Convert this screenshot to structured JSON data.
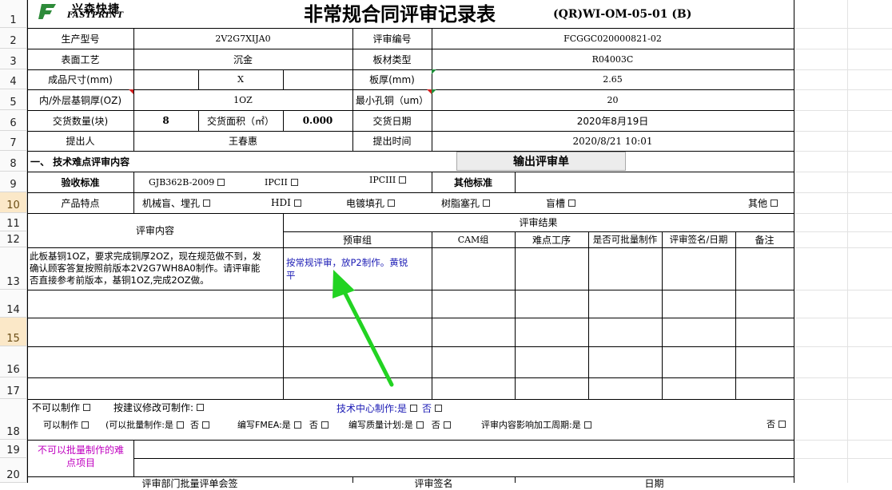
{
  "logo": {
    "brand_cn": "兴森快捷",
    "brand_en": "FASTPRINT"
  },
  "title": "非常规合同评审记录表",
  "doc_code": "(QR)WI-OM-05-01 (B)",
  "rows": [
    "1",
    "2",
    "3",
    "4",
    "5",
    "6",
    "7",
    "8",
    "9",
    "10",
    "11",
    "12",
    "13",
    "14",
    "15",
    "16",
    "17",
    "18",
    "19",
    "20"
  ],
  "info": {
    "model_label": "生产型号",
    "model_value": "2V2G7XIJA0",
    "review_no_label": "评审编号",
    "review_no_value": "FCGGC020000821-02",
    "surface_label": "表面工艺",
    "surface_value": "沉金",
    "material_label": "板材类型",
    "material_value": "R04003C",
    "size_label": "成品尺寸(mm)",
    "size_x": "X",
    "thickness_label": "板厚(mm)",
    "thickness_value": "2.65",
    "copper_label": "内/外层基铜厚(OZ)",
    "copper_value": "1OZ",
    "min_hole_label": "最小孔铜（um）",
    "min_hole_value": "20",
    "qty_label": "交货数量(块)",
    "qty_value": "8",
    "area_label": "交货面积（㎡）",
    "area_value": "0.000",
    "delivery_label": "交货日期",
    "delivery_value": "2020年8月19日",
    "proposer_label": "提出人",
    "proposer_value": "王春惠",
    "time_label": "提出时间",
    "time_value": "2020/8/21  10:01"
  },
  "section1": "一、 技术难点评审内容",
  "export_button": "输出评审单",
  "acceptance": {
    "label": "验收标准",
    "opt1": "GJB362B-2009",
    "opt2": "IPCII",
    "opt3": "IPCIII",
    "other_label": "其他标准"
  },
  "features": {
    "label": "产品特点",
    "opt1": "机械盲、埋孔",
    "opt2": "HDI",
    "opt3": "电镀填孔",
    "opt4": "树脂塞孔",
    "opt5": "盲槽",
    "opt6": "其他"
  },
  "review": {
    "content_header": "评审内容",
    "result_header": "评审结果",
    "cols": [
      "预审组",
      "CAM组",
      "难点工序",
      "是否可批量制作",
      "评审签名/日期",
      "备注"
    ],
    "content_lines": [
      "此板基铜1OZ，要求完成铜厚2OZ，现在规范做不到，发",
      "确认顾客答复按照前版本2V2G7WH8A0制作。请评审能",
      "否直接参考前版本，基铜1OZ,完成2OZ做。"
    ],
    "pre_review_lines": [
      "按常规评审，放P2制作。黄锐",
      "平"
    ]
  },
  "decision": {
    "cannot": "不可以制作",
    "modify": "按建议修改可制作:",
    "tech_center": "技术中心制作:是",
    "no": "否",
    "can": "可以制作",
    "batch": "(可以批量制作:是",
    "fmea": "编写FMEA:是",
    "quality_plan": "编写质量计划:是",
    "cycle": "评审内容影响加工周期:是"
  },
  "difficulty_label_1": "不可以批量制作的难",
  "difficulty_label_2": "点项目",
  "footer": {
    "col1": "评审部门批量评单会签",
    "col2": "评审签名",
    "col3": "日期"
  },
  "colors": {
    "accent_blue": "#1a1ab4",
    "magenta": "#c000c0",
    "arrow_green": "#22d322",
    "logo_green": "#2e8b3a"
  }
}
